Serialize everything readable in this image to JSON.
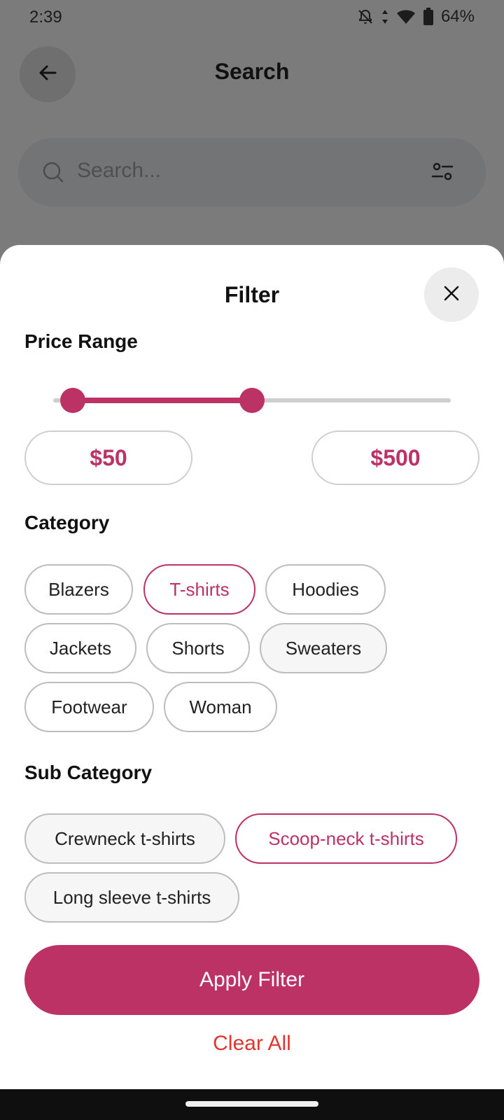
{
  "status_bar": {
    "time": "2:39",
    "battery_text": "64%",
    "icons": [
      "notifications-off-icon",
      "data-arrows-icon",
      "wifi-icon",
      "battery-icon"
    ]
  },
  "background_screen": {
    "title": "Search",
    "back_icon": "arrow-left-icon",
    "search_placeholder": "Search...",
    "search_icon": "search-icon",
    "filter_icon": "filter-sliders-icon"
  },
  "filter_sheet": {
    "title": "Filter",
    "close_icon": "close-icon",
    "price_range": {
      "label": "Price Range",
      "min_label": "$50",
      "max_label": "$500",
      "slider_low_fraction": 0.05,
      "slider_high_fraction": 0.5
    },
    "category": {
      "label": "Category",
      "chips": [
        {
          "label": "Blazers",
          "selected": false
        },
        {
          "label": "T-shirts",
          "selected": true
        },
        {
          "label": "Hoodies",
          "selected": false
        },
        {
          "label": "Jackets",
          "selected": false
        },
        {
          "label": "Shorts",
          "selected": false
        },
        {
          "label": "Sweaters",
          "selected": false
        },
        {
          "label": "Footwear",
          "selected": false
        },
        {
          "label": "Woman",
          "selected": false
        }
      ]
    },
    "sub_category": {
      "label": "Sub Category",
      "chips": [
        {
          "label": "Crewneck t-shirts",
          "selected": false
        },
        {
          "label": "Scoop-neck t-shirts",
          "selected": true
        },
        {
          "label": "Long sleeve t-shirts",
          "selected": false
        }
      ]
    },
    "apply_label": "Apply Filter",
    "clear_label": "Clear All"
  },
  "colors": {
    "accent": "#bd3264",
    "clear": "#e0362f",
    "scrim": "#7b7b7b"
  }
}
